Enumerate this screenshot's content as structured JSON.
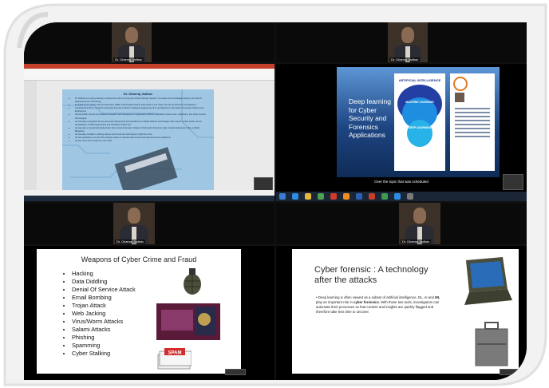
{
  "participants": {
    "top_left_name": "Dr. Dhanraj Jadhav",
    "top_right_name": "Dr. Dhanraj Jadhav",
    "mid_left_name": "Dr. Dhanraj Jadhav",
    "mid_right_name": "Dr. Dhanraj Jadhav"
  },
  "ppt": {
    "slide_heading": "Dr. Dhanraj Jadhav",
    "bullets": [
      "Dr. Dhanraj is a young visionary entrepreneur who is serving the society through research, innovation and knowledge sharing in the field of Engineering and Technology",
      "Founded an IT Industry named Cyberwave (R&D) India Private Limited, India which is into Cyber security and forensic investigations",
      "Completed his Ph.D. on Cloud Computing Security, M.Tech in Software Engineering, B.E. and Diploma in the fields of Computer Science and Engineering",
      "Served Indian Government Defence Research and Development Organisation (DRDO), awarded in data center, networking, and cyber security technologies",
      "He has been recognized for his successful deployment and operations of multiple defence technologies with respect to Data center, Server Virtualization, GTM through Cloud and Hardware in DIAT, etc.",
      "He was also a recognized academician who served Al-Ameen Institute of Information Sciences; later founded Cyberwave India, an R&D, Bangalore",
      "He has also excelled in utilizing various cyber tools and techniques to fight the crime",
      "He has published more than 50 research papers in reputed national and international research platforms",
      "He has more than 5 patents in his credit"
    ]
  },
  "share": {
    "slide_title": "Deep learning for Cyber Security and Forensics Applications",
    "ai_title": "ARTIFICIAL INTELLIGENCE",
    "ai_ml": "MACHINE LEARNING",
    "ai_dl": "DEEP LEARNING",
    "caption": "Over the topic that was scheduled"
  },
  "weapons_slide": {
    "title": "Weapons of Cyber Crime and Fraud",
    "items": [
      "Hacking",
      "Data Diddling",
      "Denial Of Service Attack",
      "Email Bombing",
      "Trojan Attack",
      "Web Jacking",
      "Virus/Worm Attacks",
      "Salami Attacks",
      "Phishing",
      "Spamming",
      "Cyber Stalking"
    ],
    "spam_label": "SPAM"
  },
  "forensic_slide": {
    "title": "Cyber forensic : A technology after the attacks",
    "para_prefix": "Deep learning is often viewed as a subset of artificial intelligence. DL, AI and ",
    "para_bold": "ML",
    "para_mid": " play an important role in ",
    "para_bold2": "cyber forensics",
    "para_suffix": ". With these two tools, investigators can automate their processes so that content and insights are quickly flagged and therefore take less time to uncover."
  },
  "colors": {
    "accent_red": "#c4402b",
    "slide_blue": "#1f4c8c",
    "light_blue": "#9fc7e4"
  }
}
